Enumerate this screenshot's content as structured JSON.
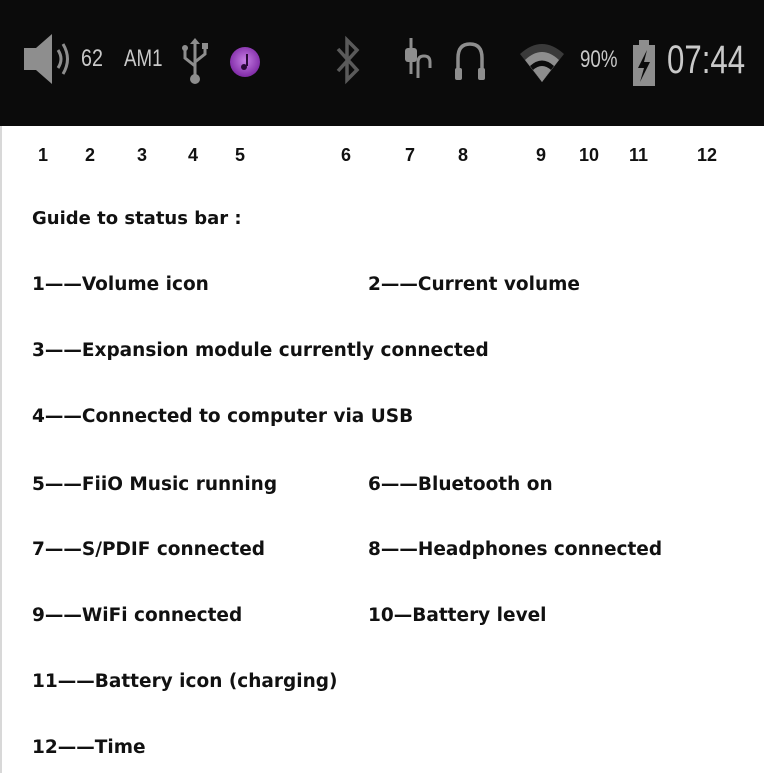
{
  "statusbar": {
    "volume_icon": "speaker-volume-icon",
    "volume_value": "62",
    "module": "AM1",
    "usb_icon": "usb-icon",
    "music_icon": "fiio-music-icon",
    "bluetooth_icon": "bluetooth-icon",
    "spdif_icon": "spdif-icon",
    "headphones_icon": "headphones-icon",
    "wifi_icon": "wifi-icon",
    "battery_level": "90%",
    "battery_icon": "battery-charging-icon",
    "time": "07:44",
    "colors": {
      "background": "#0b0b0b",
      "icon": "#8e8e8e",
      "text": "#c9c9c9",
      "music_accent": "#a03cc8"
    }
  },
  "numbers": [
    "1",
    "2",
    "3",
    "4",
    "5",
    "6",
    "7",
    "8",
    "9",
    "10",
    "11",
    "12"
  ],
  "guide": {
    "title": "Guide to status bar :",
    "items": [
      "1——Volume icon",
      "2——Current volume",
      "3——Expansion module currently connected",
      "4——Connected to computer via USB",
      "5——FiiO Music running",
      "6——Bluetooth on",
      "7——S/PDIF connected",
      "8——Headphones connected",
      "9——WiFi connected",
      "10—Battery level",
      "11——Battery icon (charging)",
      "12——Time"
    ]
  }
}
